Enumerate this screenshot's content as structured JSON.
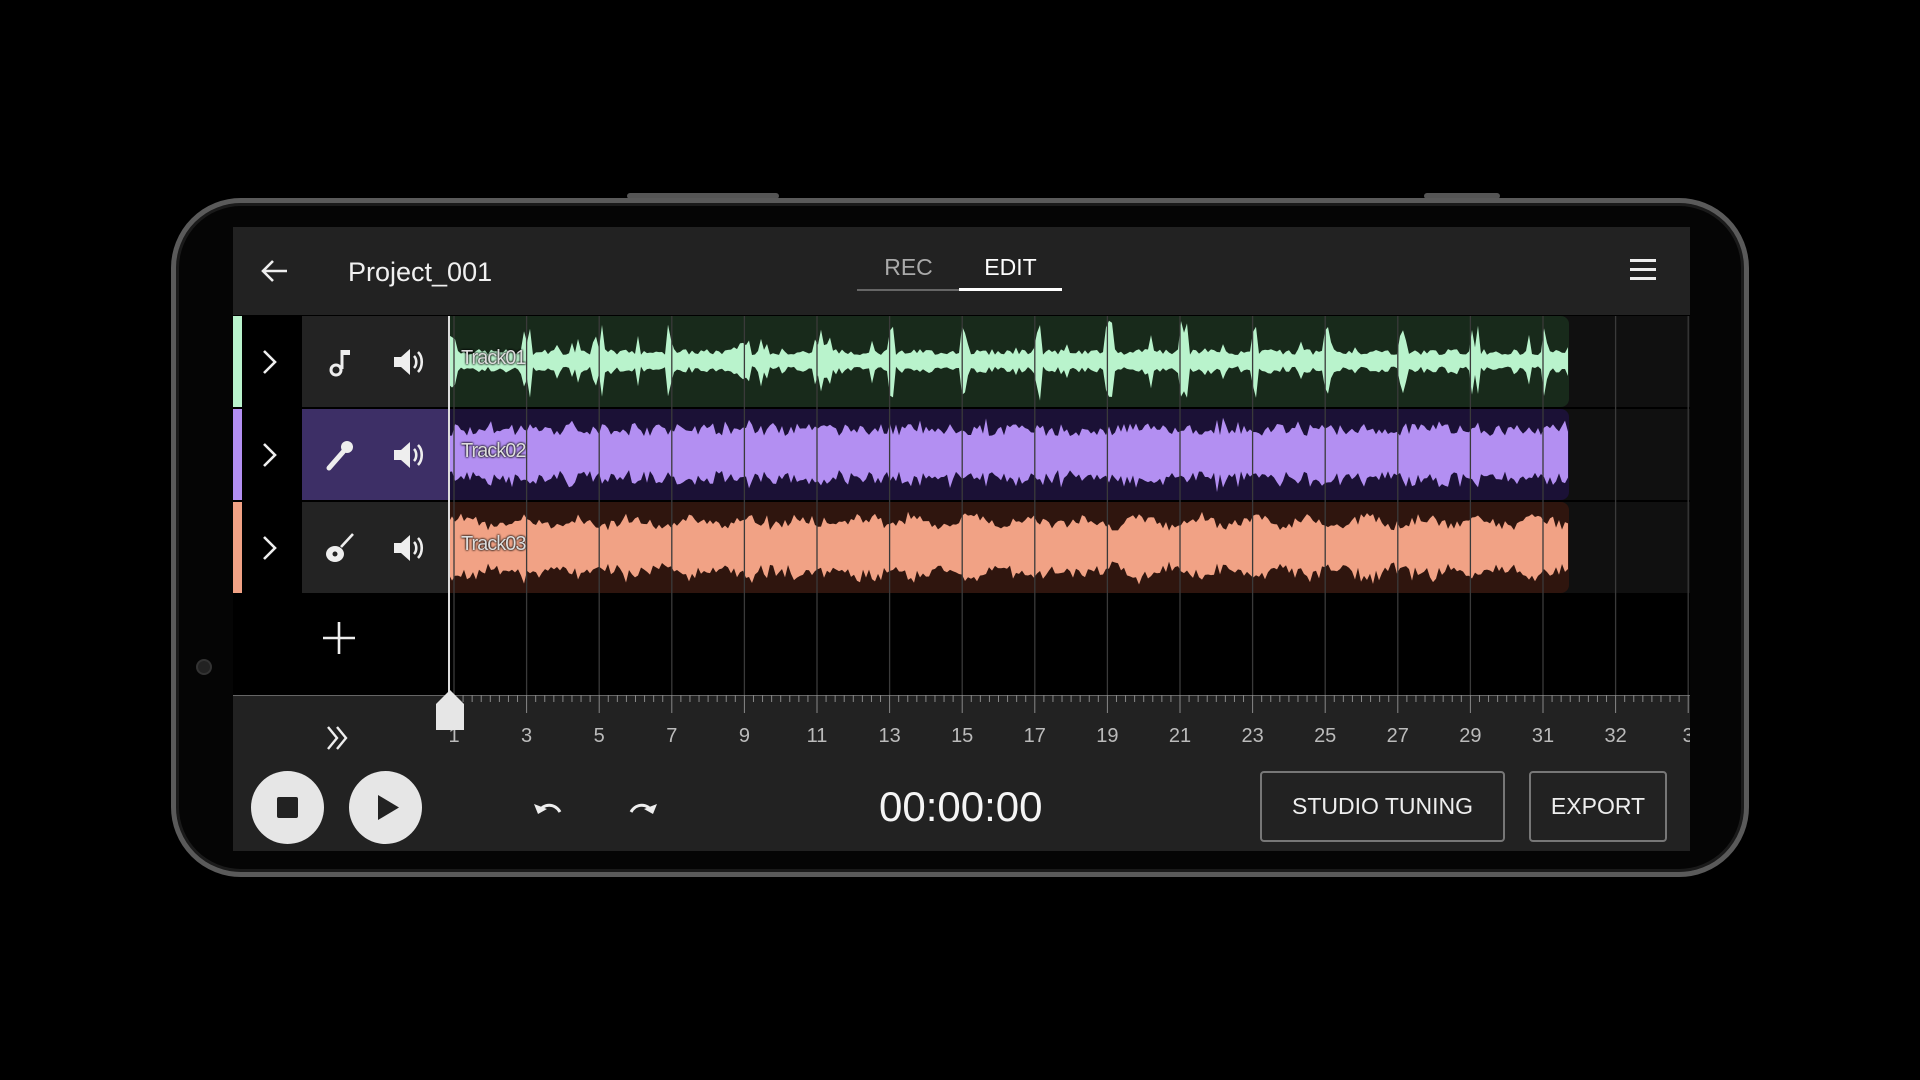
{
  "header": {
    "title": "Project_001",
    "back_icon": "arrow-left-icon",
    "menu_icon": "hamburger-menu-icon",
    "tabs": [
      {
        "label": "REC",
        "active": false
      },
      {
        "label": "EDIT",
        "active": true
      }
    ]
  },
  "tracks": [
    {
      "name": "Track01",
      "icon": "music-note-icon",
      "color": "#b9f3cc",
      "bg": "#182a1b",
      "selected": false
    },
    {
      "name": "Track02",
      "icon": "microphone-icon",
      "color": "#b38ff2",
      "bg": "#1b1136",
      "selected": true
    },
    {
      "name": "Track03",
      "icon": "guitar-icon",
      "color": "#f1a285",
      "bg": "#2f150e",
      "selected": false
    }
  ],
  "ruler": {
    "labels": [
      "1",
      "3",
      "5",
      "7",
      "9",
      "11",
      "13",
      "15",
      "17",
      "19",
      "21",
      "23",
      "25",
      "27",
      "29",
      "31",
      "32",
      "3"
    ]
  },
  "transport": {
    "time": "00:00:00"
  },
  "buttons": {
    "studio_tuning": "STUDIO TUNING",
    "export": "EXPORT"
  }
}
